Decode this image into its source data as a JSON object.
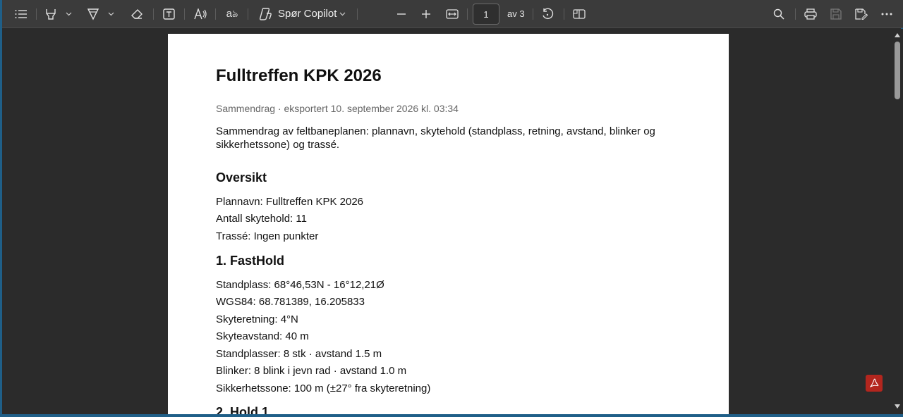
{
  "toolbar": {
    "copilot_label": "Spør Copilot",
    "page_current": "1",
    "page_of": "av 3"
  },
  "document": {
    "title": "Fulltreffen KPK 2026",
    "meta": "Sammendrag · eksportert 10. september 2026 kl. 03:34",
    "intro": "Sammendrag av feltbaneplanen: plannavn, skytehold (standplass, retning, avstand, blinker og sikkerhetssone) og trassé.",
    "overview": {
      "heading": "Oversikt",
      "lines": [
        "Plannavn: Fulltreffen KPK 2026",
        "Antall skytehold: 11",
        "Trassé: Ingen punkter"
      ]
    },
    "section1": {
      "heading": "1. FastHold",
      "lines": [
        "Standplass: 68°46,53N - 16°12,21Ø",
        "WGS84: 68.781389, 16.205833",
        "Skyteretning: 4°N",
        "Skyteavstand: 40 m",
        "Standplasser: 8 stk · avstand 1.5 m",
        "Blinker: 8 blink i jevn rad · avstand 1.0 m",
        "Sikkerhetssone: 100 m (±27° fra skyteretning)"
      ]
    },
    "section2": {
      "heading": "2. Hold 1"
    }
  }
}
